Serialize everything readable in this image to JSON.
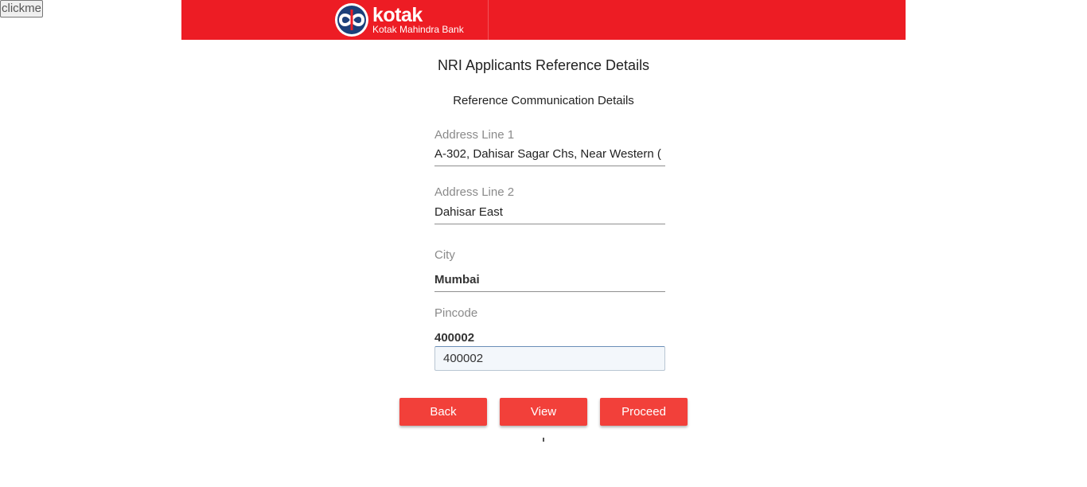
{
  "debug_button": {
    "label": "clickme"
  },
  "header": {
    "brand_name": "kotak",
    "brand_subtitle": "Kotak Mahindra Bank",
    "brand_color": "#ed1c24",
    "logo_icon": "kotak-infinity-logo"
  },
  "page": {
    "title": "NRI Applicants Reference Details",
    "section_title": "Reference Communication Details"
  },
  "form": {
    "address_line1": {
      "label": "Address Line 1",
      "value": "A-302, Dahisar Sagar Chs, Near Western ("
    },
    "address_line2": {
      "label": "Address Line 2",
      "value": "Dahisar East"
    },
    "city": {
      "label": "City",
      "value": "Mumbai"
    },
    "pincode": {
      "label": "Pincode",
      "value": "400002",
      "input_value": "400002"
    }
  },
  "actions": {
    "back_label": "Back",
    "view_label": "View",
    "proceed_label": "Proceed",
    "button_color": "#f2403a"
  }
}
